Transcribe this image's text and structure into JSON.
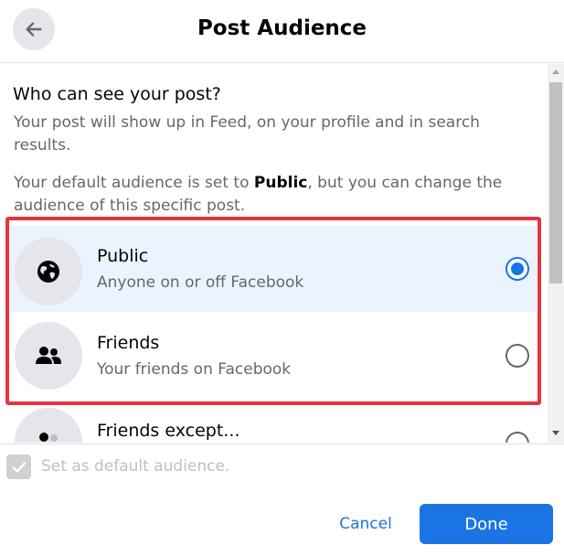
{
  "header": {
    "title": "Post Audience",
    "back_icon": "arrow-left-icon"
  },
  "intro": {
    "heading": "Who can see your post?",
    "description": "Your post will show up in Feed, on your profile and in search results.",
    "default_prefix": "Your default audience is set to ",
    "default_value": "Public",
    "default_suffix": ", but you can change the audience of this specific post."
  },
  "options": [
    {
      "title": "Public",
      "subtitle": "Anyone on or off Facebook",
      "icon": "globe-icon",
      "selected": true
    },
    {
      "title": "Friends",
      "subtitle": "Your friends on Facebook",
      "icon": "friends-icon",
      "selected": false
    },
    {
      "title": "Friends except...",
      "subtitle": "",
      "icon": "friends-except-icon",
      "selected": false
    }
  ],
  "footer": {
    "checkbox_label": "Set as default audience.",
    "checkbox_checked": true,
    "cancel_label": "Cancel",
    "done_label": "Done"
  },
  "colors": {
    "accent": "#1b74e4",
    "selected_bg": "#ebf3ff",
    "highlight": "#e5343e",
    "secondary_text": "#65676b"
  }
}
